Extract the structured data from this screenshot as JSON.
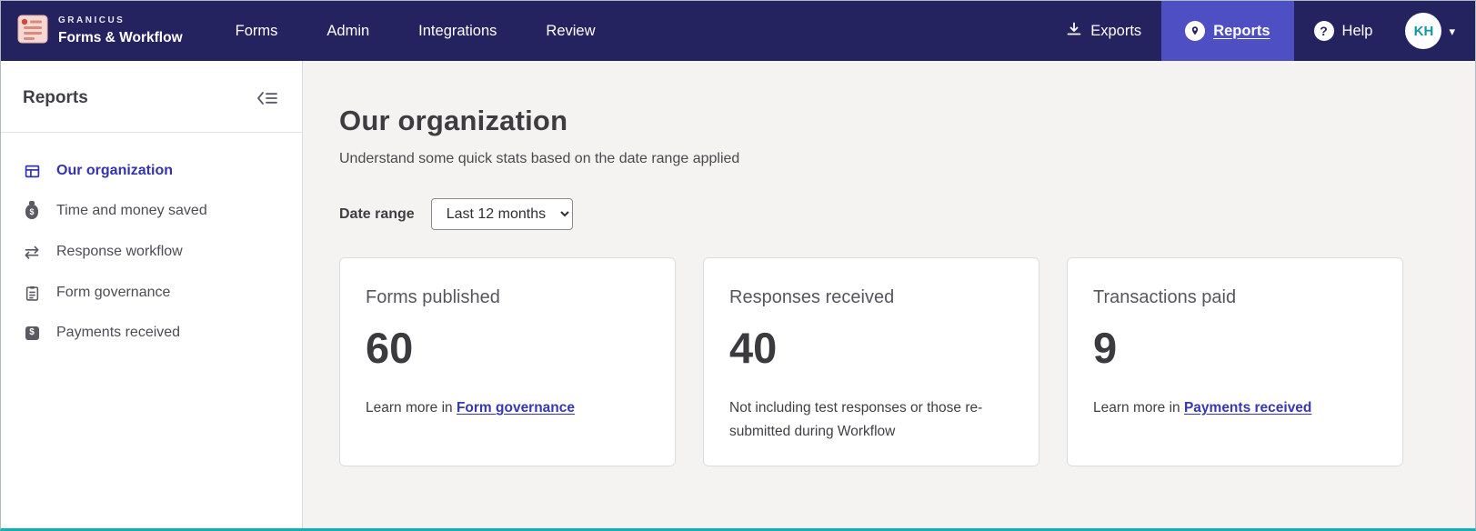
{
  "colors": {
    "navbar_bg": "#24225f",
    "navbar_active_bg": "#4e4fc3",
    "accent_indigo": "#3737b2",
    "avatar_teal": "#0d98a5",
    "main_bg": "#f4f3f1",
    "bottom_edge_teal": "#12aebd"
  },
  "navbar": {
    "brand": {
      "company": "GRANICUS",
      "product": "Forms & Workflow"
    },
    "items": [
      {
        "label": "Forms"
      },
      {
        "label": "Admin"
      },
      {
        "label": "Integrations"
      },
      {
        "label": "Review"
      }
    ],
    "exports_label": "Exports",
    "reports_label": "Reports",
    "help_label": "Help",
    "help_glyph": "?",
    "avatar_initials": "KH",
    "caret_glyph": "▾"
  },
  "sidebar": {
    "title": "Reports",
    "items": [
      {
        "label": "Our organization"
      },
      {
        "label": "Time and money saved"
      },
      {
        "label": "Response workflow"
      },
      {
        "label": "Form governance"
      },
      {
        "label": "Payments received"
      }
    ],
    "glyphs": {
      "dollar": "$",
      "workflow": "⇄"
    }
  },
  "main": {
    "title": "Our organization",
    "subtitle": "Understand some quick stats based on the date range applied",
    "date_range_label": "Date range",
    "date_range_value": "Last 12 months",
    "cards": [
      {
        "title": "Forms published",
        "value": "60",
        "note_prefix": "Learn more in ",
        "link_label": "Form governance"
      },
      {
        "title": "Responses received",
        "value": "40",
        "note": "Not including test responses or those re-submitted during Workflow"
      },
      {
        "title": "Transactions paid",
        "value": "9",
        "note_prefix": "Learn more in ",
        "link_label": "Payments received"
      }
    ]
  }
}
